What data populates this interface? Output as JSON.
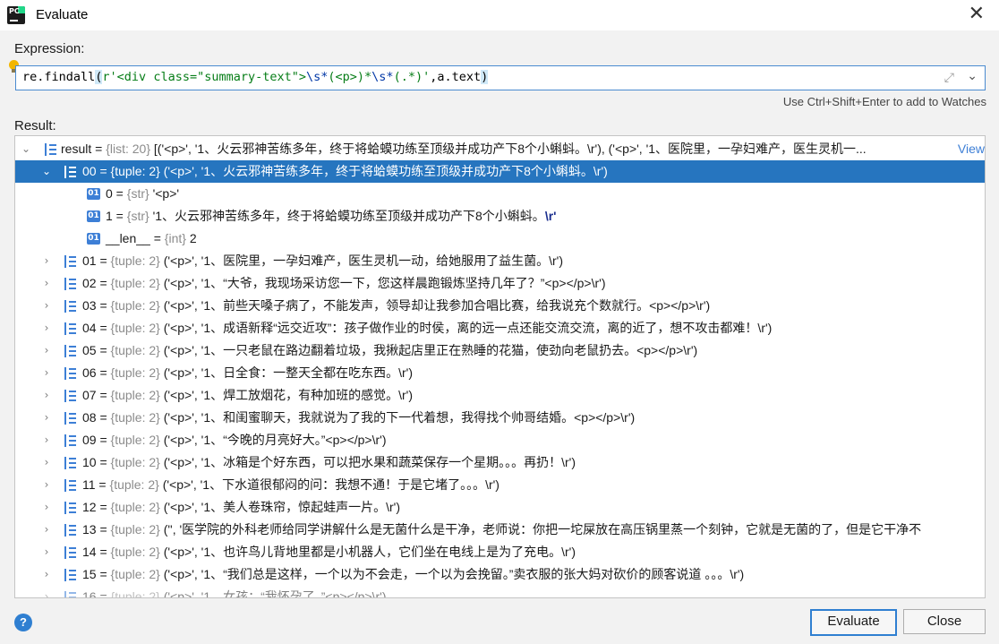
{
  "window": {
    "title": "Evaluate",
    "app_icon_text": "PC"
  },
  "expression": {
    "label": "Expression:",
    "parts": {
      "fn": "re.findall",
      "open": "(",
      "pattern": "r'<div class=\"summary-text\">",
      "esc1": "\\s*",
      "group1": "(<p>)*",
      "esc2": "\\s*",
      "group2": "(.*)",
      "quote_close": "'",
      "arg2": ",a.text",
      "close": ")"
    },
    "hint": "Use Ctrl+Shift+Enter to add to Watches"
  },
  "result": {
    "label": "Result:",
    "root": {
      "name": "result",
      "type": "{list: 20}",
      "value": "[('<p>', '1、火云邪神苦练多年，终于将蛤蟆功练至顶级并成功产下8个小蝌蚪。\\r'), ('<p>', '1、医院里，一孕妇难产，医生灵机一...",
      "view_link": "View"
    },
    "selected": {
      "name": "00",
      "type": "{tuple: 2}",
      "value": "('<p>', '1、火云邪神苦练多年，终于将蛤蟆功练至顶级并成功产下8个小蝌蚪。\\r')"
    },
    "children": [
      {
        "name": "0",
        "type": "{str}",
        "value": "'<p>'",
        "esc": ""
      },
      {
        "name": "1",
        "type": "{str}",
        "value": "'1、火云邪神苦练多年，终于将蛤蟆功练至顶级并成功产下8个小蝌蚪。",
        "esc": "\\r'"
      },
      {
        "name": "__len__",
        "type": "{int}",
        "value": "2",
        "esc": ""
      }
    ],
    "items": [
      {
        "name": "01",
        "type": "{tuple: 2}",
        "value": "('<p>', '1、医院里，一孕妇难产，医生灵机一动，给她服用了益生菌。\\r')"
      },
      {
        "name": "02",
        "type": "{tuple: 2}",
        "value": "('<p>', '1、“大爷，我现场采访您一下，您这样晨跑锻炼坚持几年了？”<p></p>\\r')"
      },
      {
        "name": "03",
        "type": "{tuple: 2}",
        "value": "('<p>', '1、前些天嗓子病了，不能发声，领导却让我参加合唱比赛，给我说充个数就行。<p></p>\\r')"
      },
      {
        "name": "04",
        "type": "{tuple: 2}",
        "value": "('<p>', '1、成语新释“远交近攻”：孩子做作业的时侯，离的远一点还能交流交流，离的近了，想不攻击都难！\\r')"
      },
      {
        "name": "05",
        "type": "{tuple: 2}",
        "value": "('<p>', '1、一只老鼠在路边翻着垃圾，我揪起店里正在熟睡的花猫，使劲向老鼠扔去。<p></p>\\r')"
      },
      {
        "name": "06",
        "type": "{tuple: 2}",
        "value": "('<p>', '1、日全食：一整天全都在吃东西。\\r')"
      },
      {
        "name": "07",
        "type": "{tuple: 2}",
        "value": "('<p>', '1、焊工放烟花，有种加班的感觉。\\r')"
      },
      {
        "name": "08",
        "type": "{tuple: 2}",
        "value": "('<p>', '1、和闺蜜聊天，我就说为了我的下一代着想，我得找个帅哥结婚。<p></p>\\r')"
      },
      {
        "name": "09",
        "type": "{tuple: 2}",
        "value": "('<p>', '1、“今晚的月亮好大。”<p></p>\\r')"
      },
      {
        "name": "10",
        "type": "{tuple: 2}",
        "value": "('<p>', '1、冰箱是个好东西，可以把水果和蔬菜保存一个星期。。。再扔！\\r')"
      },
      {
        "name": "11",
        "type": "{tuple: 2}",
        "value": "('<p>', '1、下水道很郁闷的问：我想不通！于是它堵了。。。\\r')"
      },
      {
        "name": "12",
        "type": "{tuple: 2}",
        "value": "('<p>', '1、美人卷珠帘，惊起蛙声一片。\\r')"
      },
      {
        "name": "13",
        "type": "{tuple: 2}",
        "value": "('', '医学院的外科老师给同学讲解什么是无菌什么是干净，老师说：你把一坨屎放在高压锅里蒸一个刻钟，它就是无菌的了，但是它干净不"
      },
      {
        "name": "14",
        "type": "{tuple: 2}",
        "value": "('<p>', '1、也许鸟儿背地里都是小机器人，它们坐在电线上是为了充电。\\r')"
      },
      {
        "name": "15",
        "type": "{tuple: 2}",
        "value": "('<p>', '1、“我们总是这样，一个以为不会走，一个以为会挽留。”卖衣服的张大妈对砍价的顾客说道 。。。\\r')"
      },
      {
        "name": "16",
        "type": "{tuple: 2}",
        "value": "('<p>', '1、女孩：“我怀孕了。”<p></p>\\r')"
      }
    ]
  },
  "buttons": {
    "help": "?",
    "evaluate": "Evaluate",
    "close": "Close"
  },
  "colors": {
    "selection": "#2675bf",
    "accent": "#2f7fd1",
    "string": "#067d17",
    "escape": "#0037a6"
  }
}
